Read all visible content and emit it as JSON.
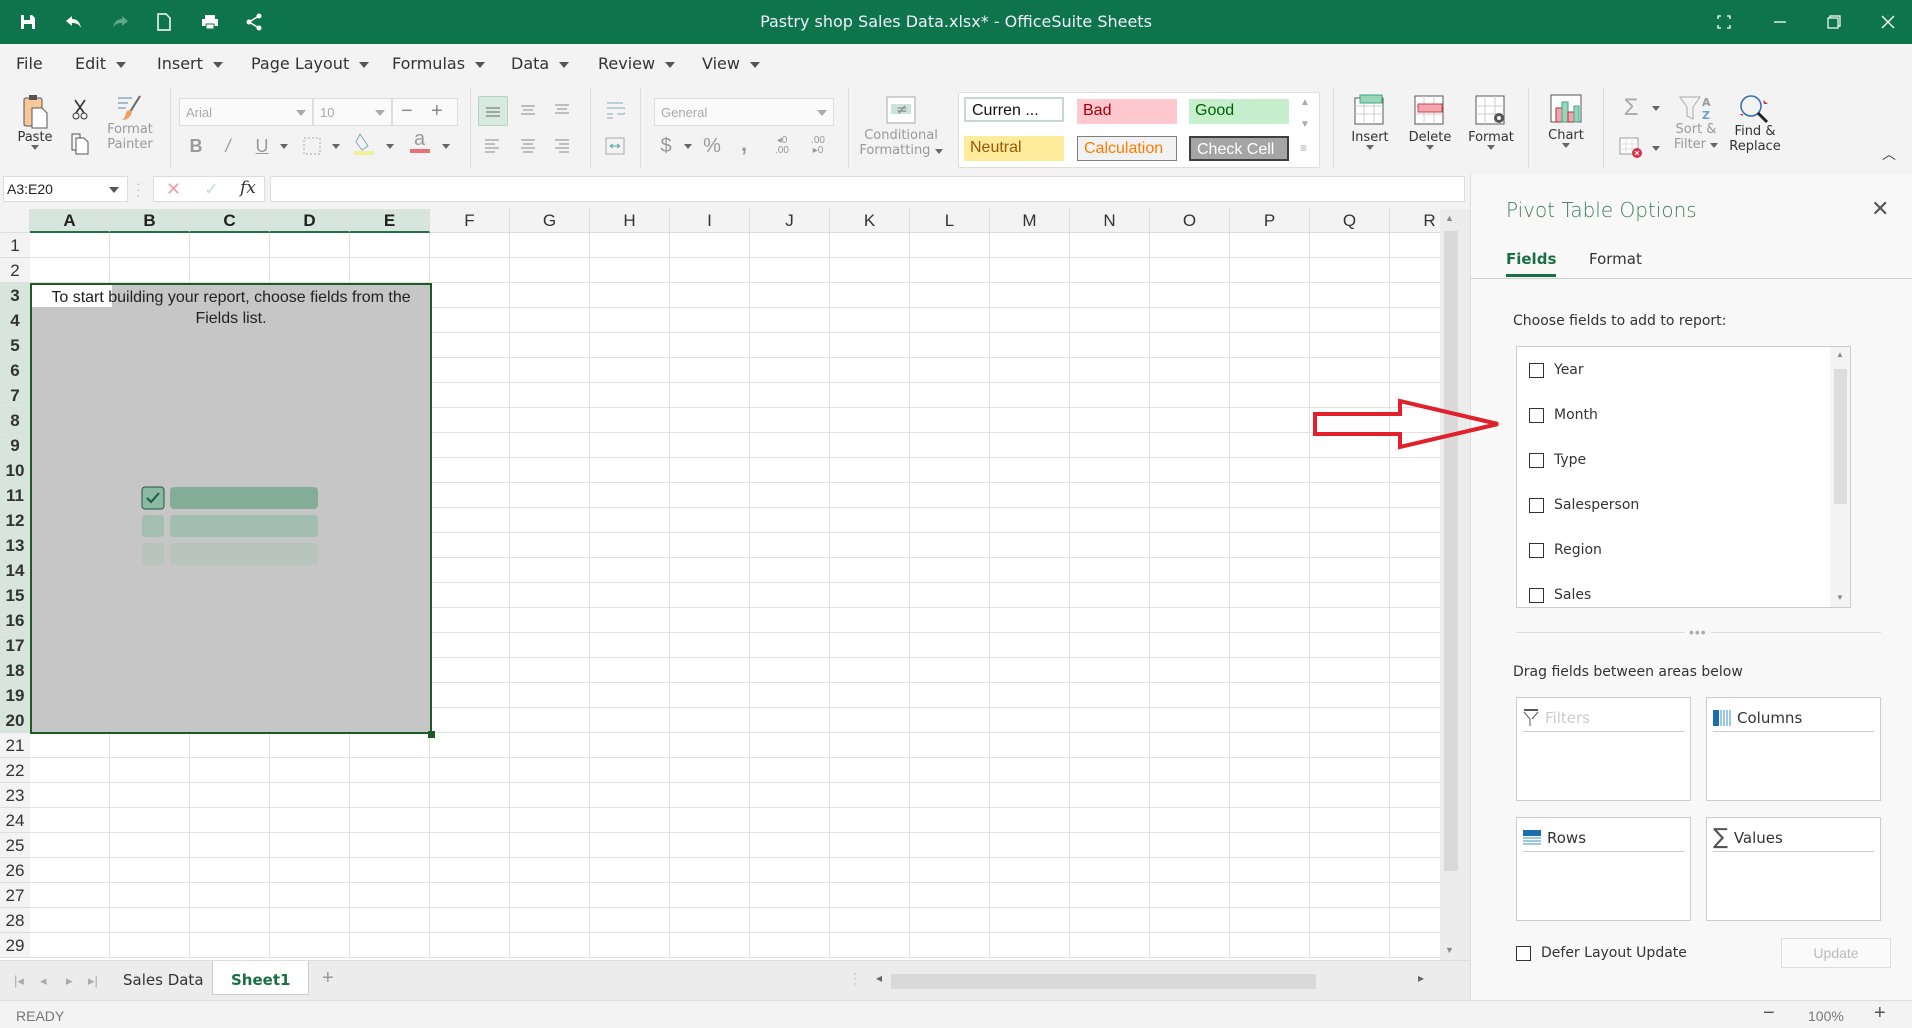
{
  "window": {
    "title": "Pastry shop Sales Data.xlsx* - OfficeSuite Sheets",
    "quick_access": [
      "save-icon",
      "undo-icon",
      "redo-icon",
      "new-document-icon",
      "print-icon",
      "share-icon"
    ],
    "controls": [
      "fullscreen-icon",
      "minimize-icon",
      "restore-icon",
      "close-icon"
    ]
  },
  "menu": {
    "items": [
      {
        "label": "File",
        "caret": false
      },
      {
        "label": "Edit",
        "caret": true
      },
      {
        "label": "Insert",
        "caret": true
      },
      {
        "label": "Page Layout",
        "caret": true
      },
      {
        "label": "Formulas",
        "caret": true
      },
      {
        "label": "Data",
        "caret": true
      },
      {
        "label": "Review",
        "caret": true
      },
      {
        "label": "View",
        "caret": true
      }
    ]
  },
  "ribbon": {
    "paste": "Paste",
    "format_painter_line1": "Format",
    "format_painter_line2": "Painter",
    "font_name": "Arial",
    "font_size": "10",
    "number_format": "General",
    "conditional_line1": "Conditional",
    "conditional_line2": "Formatting",
    "styles": {
      "currency": "Curren ...",
      "bad": "Bad",
      "good": "Good",
      "neutral": "Neutral",
      "calculation": "Calculation",
      "check_cell": "Check Cell"
    },
    "insert": "Insert",
    "delete": "Delete",
    "format": "Format",
    "chart": "Chart",
    "sort_line1": "Sort &",
    "sort_line2": "Filter",
    "find_line1": "Find &",
    "find_line2": "Replace",
    "colors": {
      "bad_bg": "#ffc7ce",
      "bad_fg": "#9c0006",
      "good_bg": "#c6efce",
      "good_fg": "#006100",
      "neutral_bg": "#ffeb9c",
      "neutral_fg": "#9c5700",
      "calc_fg": "#fa7d00",
      "check_bg": "#a5a5a5"
    }
  },
  "formula_bar": {
    "name_box": "A3:E20",
    "fx": "fx",
    "formula": ""
  },
  "grid": {
    "columns": [
      "A",
      "B",
      "C",
      "D",
      "E",
      "F",
      "G",
      "H",
      "I",
      "J",
      "K",
      "L",
      "M",
      "N",
      "O",
      "P",
      "Q",
      "R"
    ],
    "selected_columns": [
      "A",
      "B",
      "C",
      "D",
      "E"
    ],
    "rows": [
      1,
      2,
      3,
      4,
      5,
      6,
      7,
      8,
      9,
      10,
      11,
      12,
      13,
      14,
      15,
      16,
      17,
      18,
      19,
      20,
      21,
      22,
      23,
      24,
      25,
      26,
      27,
      28,
      29
    ],
    "selected_rows_from": 3,
    "selected_rows_to": 20,
    "pivot_message": "To start building your report, choose fields from the Fields list."
  },
  "sheets": {
    "tabs": [
      "Sales Data",
      "Sheet1"
    ],
    "active": "Sheet1",
    "add": "+"
  },
  "status": {
    "text": "READY",
    "zoom": "100%",
    "zoom_out": "−",
    "zoom_in": "+"
  },
  "pivot_panel": {
    "title": "Pivot Table Options",
    "tabs": [
      "Fields",
      "Format"
    ],
    "active_tab": "Fields",
    "choose_label": "Choose fields to add to report:",
    "fields": [
      {
        "label": "Year",
        "checked": false
      },
      {
        "label": "Month",
        "checked": false
      },
      {
        "label": "Type",
        "checked": false
      },
      {
        "label": "Salesperson",
        "checked": false
      },
      {
        "label": "Region",
        "checked": false
      },
      {
        "label": "Sales",
        "checked": false
      }
    ],
    "drag_label": "Drag fields between areas below",
    "areas": {
      "filters": "Filters",
      "columns": "Columns",
      "rows": "Rows",
      "values": "Values"
    },
    "defer_label": "Defer Layout Update",
    "update_label": "Update"
  },
  "annotation": {
    "arrow_color": "#e0202a"
  }
}
